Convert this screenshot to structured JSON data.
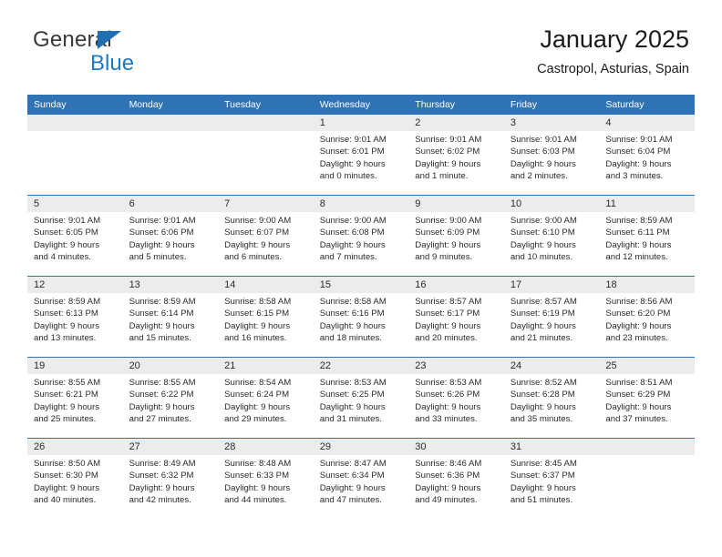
{
  "brand": {
    "name_top": "General",
    "name_bottom": "Blue",
    "triangle_color": "#1f6fb2",
    "bottom_color": "#1f7ac4"
  },
  "header": {
    "title": "January 2025",
    "subtitle": "Castropol, Asturias, Spain"
  },
  "colors": {
    "header_blue": "#2f73b5",
    "row_separator": "#2f73b5",
    "day_band": "#ececec",
    "text": "#2b2b2b"
  },
  "weekdays": [
    "Sunday",
    "Monday",
    "Tuesday",
    "Wednesday",
    "Thursday",
    "Friday",
    "Saturday"
  ],
  "weeks": [
    [
      {
        "day": "",
        "sunrise": "",
        "sunset": "",
        "daylight": ""
      },
      {
        "day": "",
        "sunrise": "",
        "sunset": "",
        "daylight": ""
      },
      {
        "day": "",
        "sunrise": "",
        "sunset": "",
        "daylight": ""
      },
      {
        "day": "1",
        "sunrise": "Sunrise: 9:01 AM",
        "sunset": "Sunset: 6:01 PM",
        "daylight": "Daylight: 9 hours and 0 minutes."
      },
      {
        "day": "2",
        "sunrise": "Sunrise: 9:01 AM",
        "sunset": "Sunset: 6:02 PM",
        "daylight": "Daylight: 9 hours and 1 minute."
      },
      {
        "day": "3",
        "sunrise": "Sunrise: 9:01 AM",
        "sunset": "Sunset: 6:03 PM",
        "daylight": "Daylight: 9 hours and 2 minutes."
      },
      {
        "day": "4",
        "sunrise": "Sunrise: 9:01 AM",
        "sunset": "Sunset: 6:04 PM",
        "daylight": "Daylight: 9 hours and 3 minutes."
      }
    ],
    [
      {
        "day": "5",
        "sunrise": "Sunrise: 9:01 AM",
        "sunset": "Sunset: 6:05 PM",
        "daylight": "Daylight: 9 hours and 4 minutes."
      },
      {
        "day": "6",
        "sunrise": "Sunrise: 9:01 AM",
        "sunset": "Sunset: 6:06 PM",
        "daylight": "Daylight: 9 hours and 5 minutes."
      },
      {
        "day": "7",
        "sunrise": "Sunrise: 9:00 AM",
        "sunset": "Sunset: 6:07 PM",
        "daylight": "Daylight: 9 hours and 6 minutes."
      },
      {
        "day": "8",
        "sunrise": "Sunrise: 9:00 AM",
        "sunset": "Sunset: 6:08 PM",
        "daylight": "Daylight: 9 hours and 7 minutes."
      },
      {
        "day": "9",
        "sunrise": "Sunrise: 9:00 AM",
        "sunset": "Sunset: 6:09 PM",
        "daylight": "Daylight: 9 hours and 9 minutes."
      },
      {
        "day": "10",
        "sunrise": "Sunrise: 9:00 AM",
        "sunset": "Sunset: 6:10 PM",
        "daylight": "Daylight: 9 hours and 10 minutes."
      },
      {
        "day": "11",
        "sunrise": "Sunrise: 8:59 AM",
        "sunset": "Sunset: 6:11 PM",
        "daylight": "Daylight: 9 hours and 12 minutes."
      }
    ],
    [
      {
        "day": "12",
        "sunrise": "Sunrise: 8:59 AM",
        "sunset": "Sunset: 6:13 PM",
        "daylight": "Daylight: 9 hours and 13 minutes."
      },
      {
        "day": "13",
        "sunrise": "Sunrise: 8:59 AM",
        "sunset": "Sunset: 6:14 PM",
        "daylight": "Daylight: 9 hours and 15 minutes."
      },
      {
        "day": "14",
        "sunrise": "Sunrise: 8:58 AM",
        "sunset": "Sunset: 6:15 PM",
        "daylight": "Daylight: 9 hours and 16 minutes."
      },
      {
        "day": "15",
        "sunrise": "Sunrise: 8:58 AM",
        "sunset": "Sunset: 6:16 PM",
        "daylight": "Daylight: 9 hours and 18 minutes."
      },
      {
        "day": "16",
        "sunrise": "Sunrise: 8:57 AM",
        "sunset": "Sunset: 6:17 PM",
        "daylight": "Daylight: 9 hours and 20 minutes."
      },
      {
        "day": "17",
        "sunrise": "Sunrise: 8:57 AM",
        "sunset": "Sunset: 6:19 PM",
        "daylight": "Daylight: 9 hours and 21 minutes."
      },
      {
        "day": "18",
        "sunrise": "Sunrise: 8:56 AM",
        "sunset": "Sunset: 6:20 PM",
        "daylight": "Daylight: 9 hours and 23 minutes."
      }
    ],
    [
      {
        "day": "19",
        "sunrise": "Sunrise: 8:55 AM",
        "sunset": "Sunset: 6:21 PM",
        "daylight": "Daylight: 9 hours and 25 minutes."
      },
      {
        "day": "20",
        "sunrise": "Sunrise: 8:55 AM",
        "sunset": "Sunset: 6:22 PM",
        "daylight": "Daylight: 9 hours and 27 minutes."
      },
      {
        "day": "21",
        "sunrise": "Sunrise: 8:54 AM",
        "sunset": "Sunset: 6:24 PM",
        "daylight": "Daylight: 9 hours and 29 minutes."
      },
      {
        "day": "22",
        "sunrise": "Sunrise: 8:53 AM",
        "sunset": "Sunset: 6:25 PM",
        "daylight": "Daylight: 9 hours and 31 minutes."
      },
      {
        "day": "23",
        "sunrise": "Sunrise: 8:53 AM",
        "sunset": "Sunset: 6:26 PM",
        "daylight": "Daylight: 9 hours and 33 minutes."
      },
      {
        "day": "24",
        "sunrise": "Sunrise: 8:52 AM",
        "sunset": "Sunset: 6:28 PM",
        "daylight": "Daylight: 9 hours and 35 minutes."
      },
      {
        "day": "25",
        "sunrise": "Sunrise: 8:51 AM",
        "sunset": "Sunset: 6:29 PM",
        "daylight": "Daylight: 9 hours and 37 minutes."
      }
    ],
    [
      {
        "day": "26",
        "sunrise": "Sunrise: 8:50 AM",
        "sunset": "Sunset: 6:30 PM",
        "daylight": "Daylight: 9 hours and 40 minutes."
      },
      {
        "day": "27",
        "sunrise": "Sunrise: 8:49 AM",
        "sunset": "Sunset: 6:32 PM",
        "daylight": "Daylight: 9 hours and 42 minutes."
      },
      {
        "day": "28",
        "sunrise": "Sunrise: 8:48 AM",
        "sunset": "Sunset: 6:33 PM",
        "daylight": "Daylight: 9 hours and 44 minutes."
      },
      {
        "day": "29",
        "sunrise": "Sunrise: 8:47 AM",
        "sunset": "Sunset: 6:34 PM",
        "daylight": "Daylight: 9 hours and 47 minutes."
      },
      {
        "day": "30",
        "sunrise": "Sunrise: 8:46 AM",
        "sunset": "Sunset: 6:36 PM",
        "daylight": "Daylight: 9 hours and 49 minutes."
      },
      {
        "day": "31",
        "sunrise": "Sunrise: 8:45 AM",
        "sunset": "Sunset: 6:37 PM",
        "daylight": "Daylight: 9 hours and 51 minutes."
      },
      {
        "day": "",
        "sunrise": "",
        "sunset": "",
        "daylight": ""
      }
    ]
  ]
}
